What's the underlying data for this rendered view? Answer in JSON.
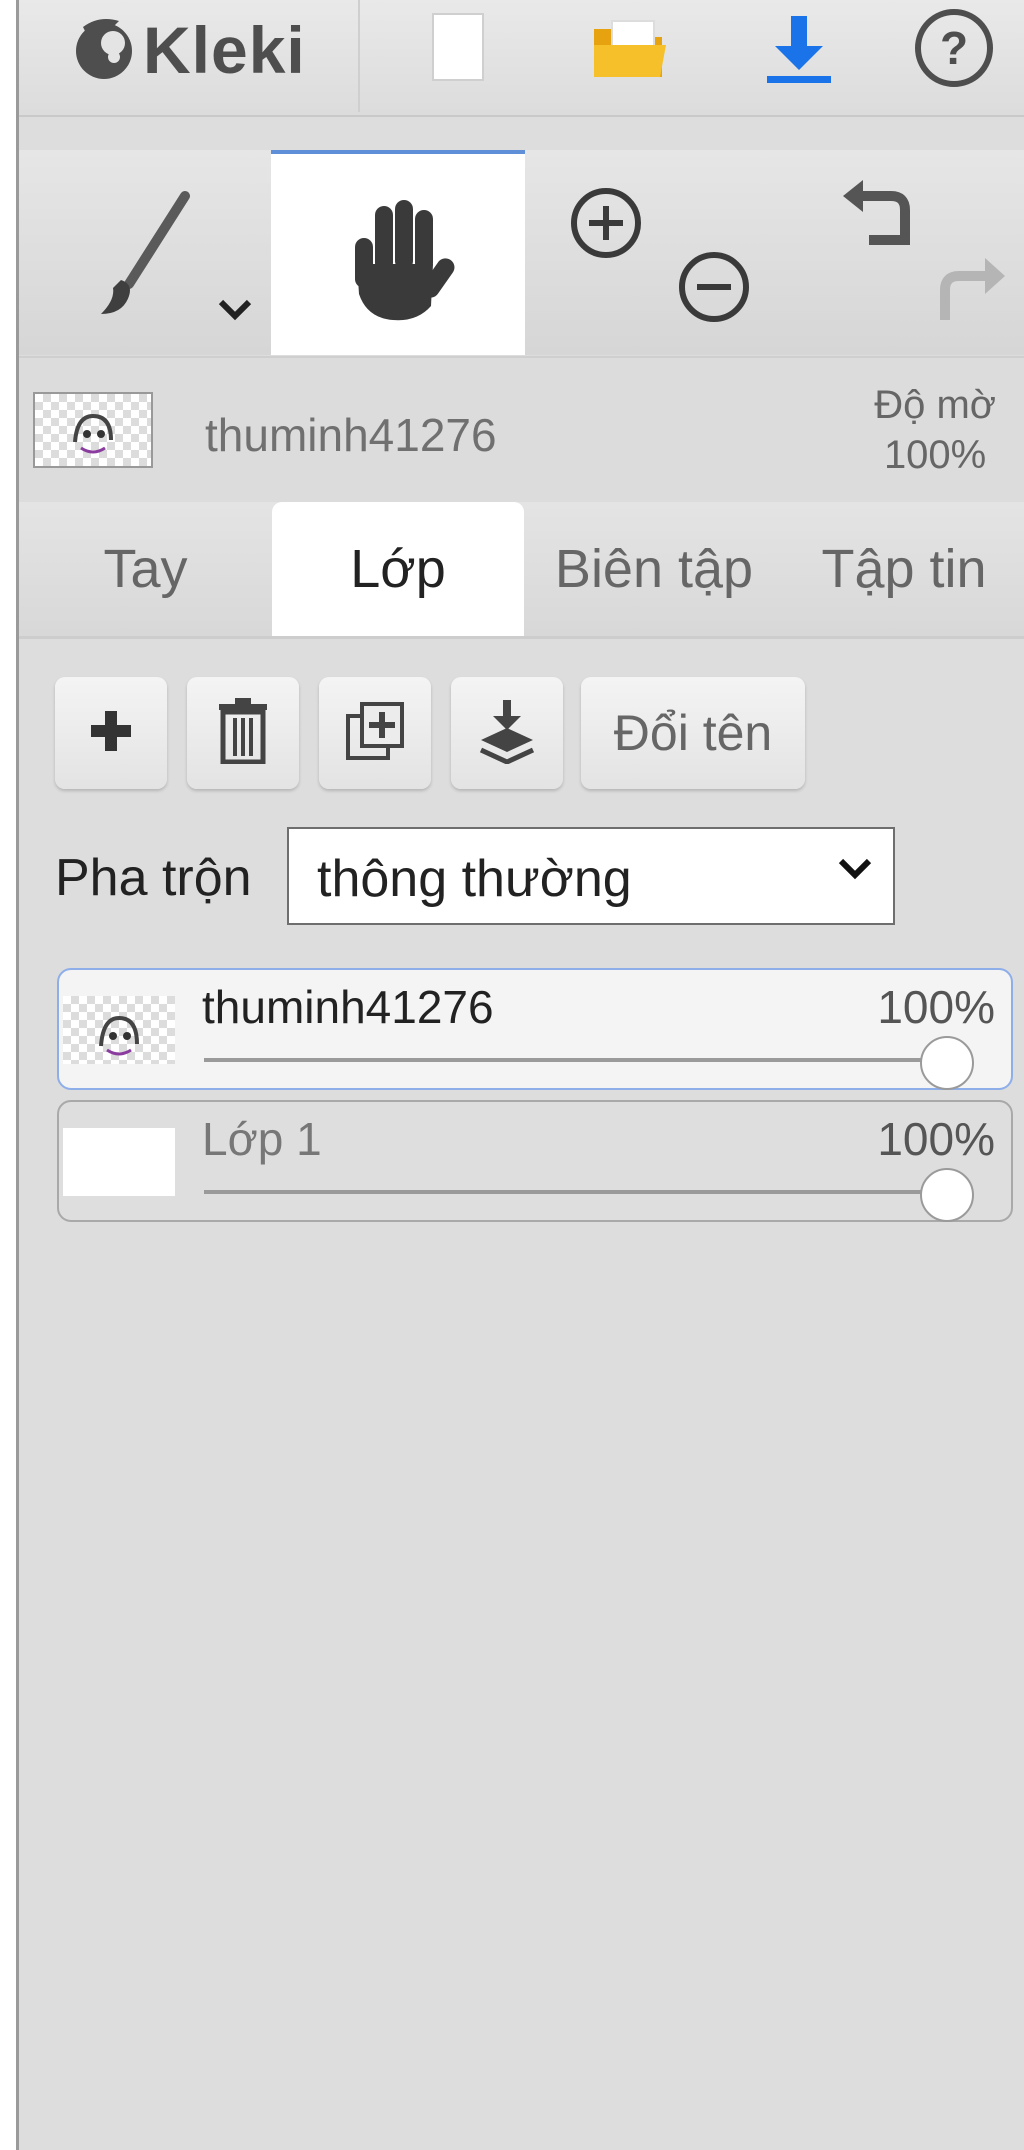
{
  "app": {
    "name": "Kleki"
  },
  "topbar": {
    "icons": [
      "new-image-icon",
      "open-folder-icon",
      "download-icon",
      "help-icon"
    ]
  },
  "tools": [
    "brush-icon",
    "hand-icon",
    "zoom-in-icon",
    "zoom-out-icon",
    "undo-icon",
    "redo-icon"
  ],
  "current_layer": {
    "name": "thuminh41276",
    "opacity_label": "Độ mờ",
    "opacity_value": "100%"
  },
  "tabs": [
    {
      "label": "Tay",
      "active": false
    },
    {
      "label": "Lớp",
      "active": true
    },
    {
      "label": "Biên tập",
      "active": false
    },
    {
      "label": "Tập tin",
      "active": false
    }
  ],
  "layer_buttons": {
    "rename": "Đổi tên"
  },
  "blend": {
    "label": "Pha trộn",
    "value": "thông thường"
  },
  "layers": [
    {
      "name": "thuminh41276",
      "opacity": "100%",
      "opacity_fraction": 1.0,
      "selected": true
    },
    {
      "name": "Lớp 1",
      "opacity": "100%",
      "opacity_fraction": 1.0,
      "selected": false
    }
  ],
  "colors": {
    "accent": "#5f8fd6",
    "download": "#1a73e8",
    "folder": "#f2b51a",
    "panel": "#dddddd"
  }
}
